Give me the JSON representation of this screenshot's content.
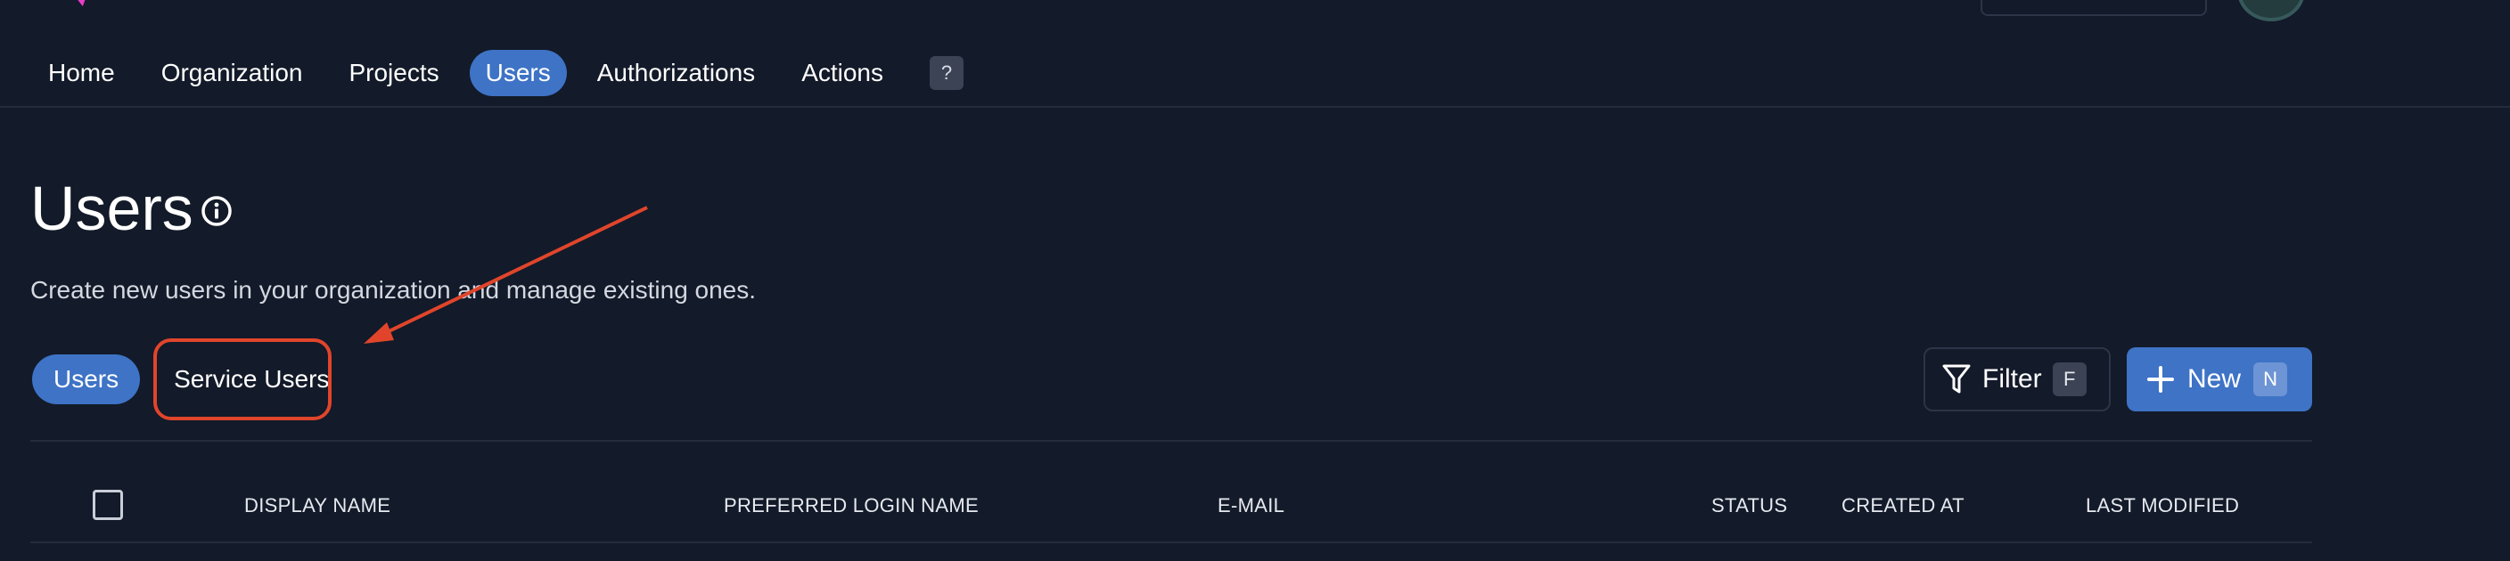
{
  "nav": {
    "items": [
      {
        "label": "Home",
        "active": false
      },
      {
        "label": "Organization",
        "active": false
      },
      {
        "label": "Projects",
        "active": false
      },
      {
        "label": "Users",
        "active": true
      },
      {
        "label": "Authorizations",
        "active": false
      },
      {
        "label": "Actions",
        "active": false
      }
    ],
    "help_label": "?"
  },
  "page": {
    "title": "Users",
    "description": "Create new users in your organization and manage existing ones."
  },
  "tabs": {
    "users": "Users",
    "service_users": "Service Users"
  },
  "toolbar": {
    "filter_label": "Filter",
    "filter_shortcut": "F",
    "new_label": "New",
    "new_shortcut": "N"
  },
  "table": {
    "columns": {
      "display_name": "DISPLAY NAME",
      "preferred_login_name": "PREFERRED LOGIN NAME",
      "email": "E-MAIL",
      "status": "STATUS",
      "created_at": "CREATED AT",
      "last_modified": "LAST MODIFIED"
    }
  },
  "colors": {
    "background": "#131a29",
    "accent": "#3e73c6",
    "annotation": "#e0452b"
  },
  "icons": [
    "logo-icon",
    "info-icon",
    "filter-icon",
    "plus-icon",
    "avatar"
  ]
}
